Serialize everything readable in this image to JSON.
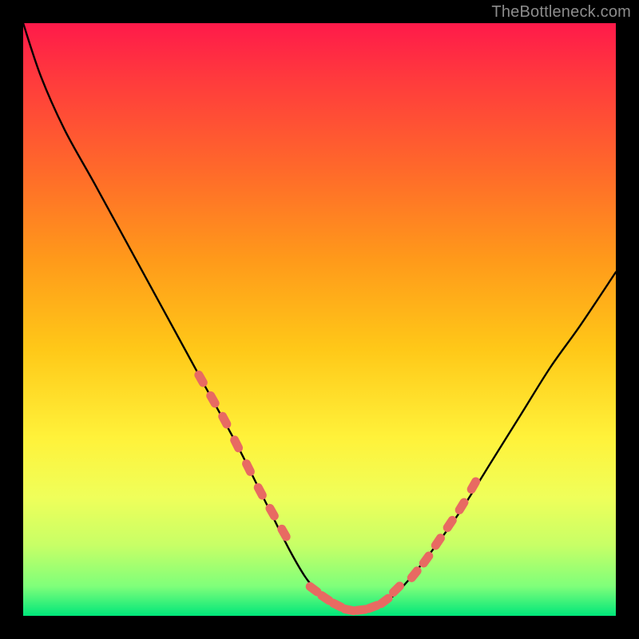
{
  "watermark": "TheBottleneck.com",
  "colors": {
    "page_bg": "#000000",
    "curve": "#000000",
    "marker_fill": "#e86a62",
    "marker_stroke": "#d15a55"
  },
  "chart_data": {
    "type": "line",
    "title": "",
    "xlabel": "",
    "ylabel": "",
    "xlim": [
      0,
      100
    ],
    "ylim": [
      0,
      100
    ],
    "grid": false,
    "legend": false,
    "annotations": [],
    "series": [
      {
        "name": "curve",
        "x": [
          0,
          3,
          7,
          12,
          18,
          24,
          30,
          36,
          41,
          45,
          48,
          51,
          53,
          55,
          57,
          59,
          62,
          65,
          69,
          74,
          79,
          84,
          89,
          94,
          100
        ],
        "y": [
          100,
          91,
          82,
          73,
          62,
          51,
          40,
          29,
          19,
          11,
          6,
          3,
          1.5,
          1,
          1,
          1.5,
          3,
          6,
          11,
          18,
          26,
          34,
          42,
          49,
          58
        ]
      }
    ],
    "markers": {
      "left_segment": {
        "x": [
          30,
          32,
          34,
          36,
          38,
          40,
          42,
          44
        ],
        "y": [
          40,
          36.5,
          33,
          29,
          25,
          21,
          17.5,
          14
        ]
      },
      "bottom_segment": {
        "x": [
          49,
          51,
          53,
          55,
          57,
          59,
          61,
          63
        ],
        "y": [
          4.5,
          3,
          1.8,
          1,
          1,
          1.5,
          2.5,
          4.5
        ]
      },
      "right_segment": {
        "x": [
          66,
          68,
          70,
          72,
          74,
          76
        ],
        "y": [
          7,
          9.5,
          12.5,
          15.5,
          18.5,
          22
        ]
      }
    }
  }
}
